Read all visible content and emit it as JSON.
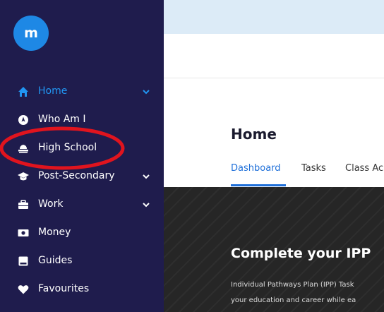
{
  "sidebar": {
    "logo_letter": "m",
    "items": [
      {
        "label": "Home",
        "icon": "home-icon",
        "active": true,
        "has_chevron": true
      },
      {
        "label": "Who Am I",
        "icon": "compass-icon",
        "active": false,
        "has_chevron": false
      },
      {
        "label": "High School",
        "icon": "school-icon",
        "active": false,
        "has_chevron": false
      },
      {
        "label": "Post-Secondary",
        "icon": "graduation-cap-icon",
        "active": false,
        "has_chevron": true
      },
      {
        "label": "Work",
        "icon": "briefcase-icon",
        "active": false,
        "has_chevron": true
      },
      {
        "label": "Money",
        "icon": "money-icon",
        "active": false,
        "has_chevron": false
      },
      {
        "label": "Guides",
        "icon": "book-icon",
        "active": false,
        "has_chevron": false
      },
      {
        "label": "Favourites",
        "icon": "heart-icon",
        "active": false,
        "has_chevron": false
      }
    ]
  },
  "main": {
    "title": "Home",
    "tabs": [
      {
        "label": "Dashboard",
        "active": true
      },
      {
        "label": "Tasks",
        "active": false
      },
      {
        "label": "Class Ac",
        "active": false
      }
    ],
    "hero": {
      "title": "Complete your IPP",
      "text_line1": "Individual Pathways Plan (IPP) Task",
      "text_line2": "your education and career while ea"
    }
  },
  "colors": {
    "sidebar_bg": "#1f1c4d",
    "accent": "#2196f3",
    "banner": "#dcebf7",
    "hero_bg": "#262626",
    "annotation": "#e0141e"
  }
}
